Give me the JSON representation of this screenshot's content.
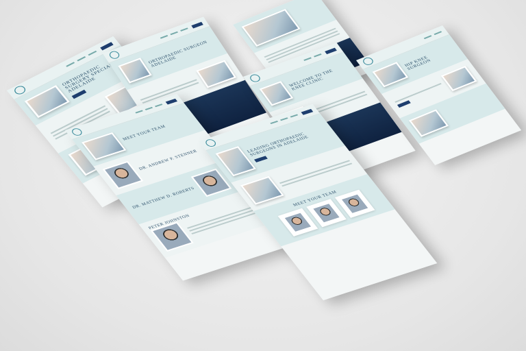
{
  "scene": {
    "description_label": "",
    "pages": [
      {
        "id": "p1",
        "hero_title": "Orthopaedic Surgery Specialist Adelaide"
      },
      {
        "id": "p2",
        "hero_title": "Orthopaedic Surgeon Adelaide"
      },
      {
        "id": "p3",
        "hero_title": ""
      },
      {
        "id": "p4",
        "hero_title": "Welcome to The Knee Clinic"
      },
      {
        "id": "p5",
        "hero_title": "Hip Knee Surgeon"
      },
      {
        "id": "p6",
        "hero_title": "Meet Your Team",
        "doctor_1": "Dr. Andrew P. Stenner",
        "doctor_2": "Dr. Matthew D. Roberts",
        "doctor_3": "Peter Johnston"
      },
      {
        "id": "p7",
        "hero_title": "Leading Orthopaedic Surgeons in Adelaide",
        "section_title": "Meet Your Team"
      }
    ]
  },
  "colors": {
    "accent": "#1e3e6e",
    "teal": "#d7e9ea",
    "text": "#2b4f6a"
  }
}
